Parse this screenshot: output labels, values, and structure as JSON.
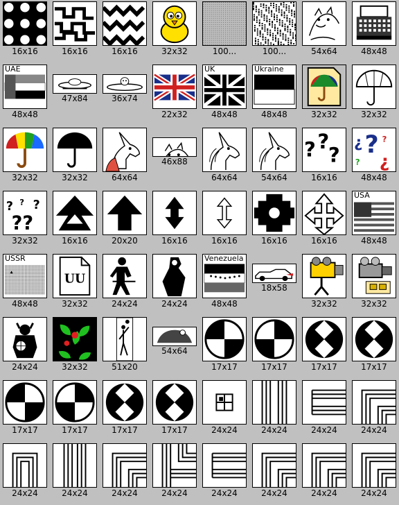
{
  "icons": [
    {
      "id": "r1c1",
      "name": "pattern-blobs",
      "caption": "16x16",
      "style": "pattern-a"
    },
    {
      "id": "r1c2",
      "name": "pattern-maze",
      "caption": "16x16",
      "style": "pattern-b"
    },
    {
      "id": "r1c3",
      "name": "pattern-zigzag",
      "caption": "16x16",
      "style": "pattern-c"
    },
    {
      "id": "r1c4",
      "name": "yellow-chick",
      "caption": "32x32",
      "style": "chick"
    },
    {
      "id": "r1c5",
      "name": "gray-texture",
      "caption": "100...",
      "style": "gray"
    },
    {
      "id": "r1c6",
      "name": "noise-texture",
      "caption": "100...",
      "style": "noise"
    },
    {
      "id": "r1c7",
      "name": "cat-face",
      "caption": "54x64",
      "style": "sketch"
    },
    {
      "id": "r1c8",
      "name": "typewriter",
      "caption": "48x48",
      "style": "typewriter"
    },
    {
      "id": "r2c1",
      "name": "flag-uae",
      "caption": "48x48",
      "style": "flag-uae",
      "label": "UAE"
    },
    {
      "id": "r2c2",
      "name": "ufo",
      "caption": "47x84",
      "style": "ufo",
      "wide": true
    },
    {
      "id": "r2c3",
      "name": "flying-saucer-pilot",
      "caption": "36x74",
      "style": "saucer",
      "wide": true
    },
    {
      "id": "r2c4",
      "name": "flag-uk-color",
      "caption": "22x32",
      "style": "uk-color"
    },
    {
      "id": "r2c5",
      "name": "flag-uk-mono",
      "caption": "48x48",
      "style": "uk-mono",
      "label": "UK"
    },
    {
      "id": "r2c6",
      "name": "flag-ukraine",
      "caption": "48x48",
      "style": "flag-ukraine",
      "label": "Ukraine"
    },
    {
      "id": "r2c7",
      "name": "umbrella-document",
      "caption": "32x32",
      "style": "umbrella-doc"
    },
    {
      "id": "r2c8",
      "name": "umbrella-outline",
      "caption": "32x32",
      "style": "umbrella-outline"
    },
    {
      "id": "r3c1",
      "name": "umbrella-color",
      "caption": "32x32",
      "style": "umbrella-color"
    },
    {
      "id": "r3c2",
      "name": "umbrella-black",
      "caption": "32x32",
      "style": "umbrella-black"
    },
    {
      "id": "r3c3",
      "name": "unicorn-color",
      "caption": "64x64",
      "style": "unicorn-color"
    },
    {
      "id": "r3c4",
      "name": "unicorn-running",
      "caption": "46x88",
      "style": "sketch",
      "wide": true
    },
    {
      "id": "r3c5",
      "name": "unicorn-head",
      "caption": "64x64",
      "style": "unicorn"
    },
    {
      "id": "r3c6",
      "name": "unicorn-head-small",
      "caption": "54x64",
      "style": "unicorn"
    },
    {
      "id": "r3c7",
      "name": "question-marks-bold",
      "caption": "16x16",
      "style": "question-bold"
    },
    {
      "id": "r3c8",
      "name": "question-marks-color",
      "caption": "48x48",
      "style": "question-color"
    },
    {
      "id": "r4c1",
      "name": "question-marks",
      "caption": "32x32",
      "style": "question-small"
    },
    {
      "id": "r4c2",
      "name": "arrow-up-double",
      "caption": "16x16",
      "style": "arrow-double"
    },
    {
      "id": "r4c3",
      "name": "arrow-up",
      "caption": "20x20",
      "style": "arrow-up"
    },
    {
      "id": "r4c4",
      "name": "arrow-up-down-bold",
      "caption": "16x16",
      "style": "arrow-updown-bold"
    },
    {
      "id": "r4c5",
      "name": "arrow-up-down-thin",
      "caption": "16x16",
      "style": "arrow-updown-thin"
    },
    {
      "id": "r4c6",
      "name": "cursor-blob",
      "caption": "16x16",
      "style": "blob"
    },
    {
      "id": "r4c7",
      "name": "arrow-cross",
      "caption": "16x16",
      "style": "arrow-cross"
    },
    {
      "id": "r4c8",
      "name": "flag-usa",
      "caption": "48x48",
      "style": "flag-usa",
      "label": "USA"
    },
    {
      "id": "r5c1",
      "name": "flag-ussr",
      "caption": "48x48",
      "style": "flag-ussr",
      "label": "USSR"
    },
    {
      "id": "r5c2",
      "name": "uu-document",
      "caption": "32x32",
      "style": "uu-doc",
      "label": "UU"
    },
    {
      "id": "r5c3",
      "name": "walking-figure",
      "caption": "24x24",
      "style": "figure"
    },
    {
      "id": "r5c4",
      "name": "vampire",
      "caption": "24x24",
      "style": "vampire"
    },
    {
      "id": "r5c5",
      "name": "flag-venezuela",
      "caption": "48x48",
      "style": "flag-venezuela",
      "label": "Venezuela"
    },
    {
      "id": "r5c6",
      "name": "sports-car",
      "caption": "18x58",
      "style": "car",
      "wide": true
    },
    {
      "id": "r5c7",
      "name": "video-camera-color",
      "caption": "32x32",
      "style": "camera-yellow"
    },
    {
      "id": "r5c8",
      "name": "video-camera",
      "caption": "32x32",
      "style": "camera-gray"
    },
    {
      "id": "r6c1",
      "name": "viking",
      "caption": "24x24",
      "style": "viking"
    },
    {
      "id": "r6c2",
      "name": "vine-leaves",
      "caption": "32x32",
      "style": "vine"
    },
    {
      "id": "r6c3",
      "name": "volleyball-player",
      "caption": "51x20",
      "style": "volley"
    },
    {
      "id": "r6c4",
      "name": "vulture",
      "caption": "54x64",
      "style": "vulture",
      "wide": true
    },
    {
      "id": "r6c5",
      "name": "checker-quarter-1",
      "caption": "17x17",
      "style": "quarter-a"
    },
    {
      "id": "r6c6",
      "name": "checker-quarter-2",
      "caption": "17x17",
      "style": "quarter-b"
    },
    {
      "id": "r6c7",
      "name": "checker-diamond-1",
      "caption": "17x17",
      "style": "diamond"
    },
    {
      "id": "r6c8",
      "name": "checker-diamond-2",
      "caption": "17x17",
      "style": "diamond"
    },
    {
      "id": "r7c1",
      "name": "checker-quarter-3",
      "caption": "17x17",
      "style": "quarter-a"
    },
    {
      "id": "r7c2",
      "name": "checker-quarter-4",
      "caption": "17x17",
      "style": "quarter-b"
    },
    {
      "id": "r7c3",
      "name": "checker-diamond-3",
      "caption": "17x17",
      "style": "diamond"
    },
    {
      "id": "r7c4",
      "name": "checker-diamond-4",
      "caption": "17x17",
      "style": "diamond"
    },
    {
      "id": "r7c5",
      "name": "window-grid",
      "caption": "24x24",
      "style": "window"
    },
    {
      "id": "r7c6",
      "name": "pipe-vertical",
      "caption": "24x24",
      "style": "pipe-v"
    },
    {
      "id": "r7c7",
      "name": "pipe-horizontal-end",
      "caption": "24x24",
      "style": "pipe-h"
    },
    {
      "id": "r7c8",
      "name": "pipe-corner-1",
      "caption": "24x24",
      "style": "pipe-corner"
    },
    {
      "id": "r8c1",
      "name": "pipe-u-bend",
      "caption": "24x24",
      "style": "pipe-u"
    },
    {
      "id": "r8c2",
      "name": "pipe-vertical-2",
      "caption": "24x24",
      "style": "pipe-v2"
    },
    {
      "id": "r8c3",
      "name": "pipe-corner-2",
      "caption": "24x24",
      "style": "pipe-corner"
    },
    {
      "id": "r8c4",
      "name": "pipe-tee",
      "caption": "24x24",
      "style": "pipe-tee"
    },
    {
      "id": "r8c5",
      "name": "pipe-horizontal",
      "caption": "24x24",
      "style": "pipe-h"
    },
    {
      "id": "r8c6",
      "name": "pipe-corner-3",
      "caption": "24x24",
      "style": "pipe-corner"
    },
    {
      "id": "r8c7",
      "name": "pipe-corner-4",
      "caption": "24x24",
      "style": "pipe-corner"
    },
    {
      "id": "r8c8",
      "name": "pipe-corner-5",
      "caption": "24x24",
      "style": "pipe-corner"
    }
  ],
  "colors": {
    "background": "#c0c0c0",
    "ink": "#000000",
    "paper": "#ffffff",
    "yellow": "#ffe000",
    "red": "#d02020",
    "blue": "#1a2f8a",
    "green": "#20c020"
  }
}
